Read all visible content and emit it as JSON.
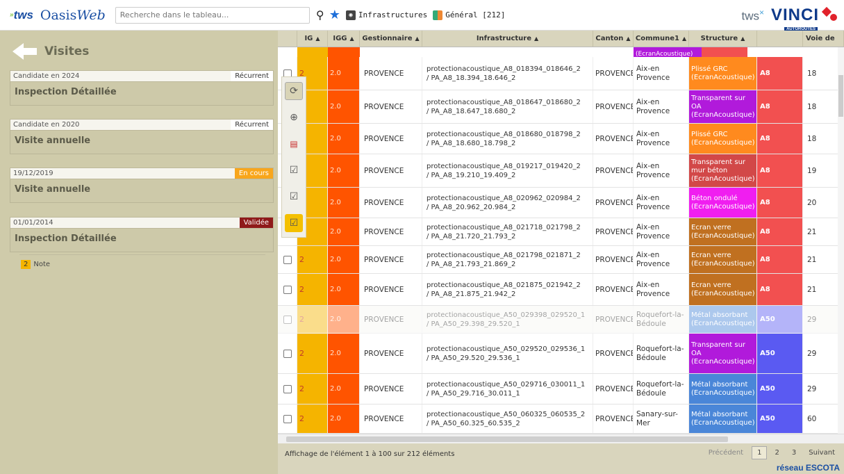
{
  "header": {
    "brand": "tws",
    "app_name_1": "Oasis",
    "app_name_2": "Web",
    "search_placeholder": "Recherche dans le tableau...",
    "chip_infra": "Infrastructures",
    "chip_general": "Général [212]",
    "right_brand": "tws",
    "right_brand_sup": "×",
    "vinci": "VINCI",
    "vinci_sub": "AUTOROUTES"
  },
  "left": {
    "title": "Visites",
    "cards": [
      {
        "label": "Candidate en 2024",
        "badge": "Récurrent",
        "badge_type": "rec",
        "body": "Inspection Détaillée"
      },
      {
        "label": "Candidate en 2020",
        "badge": "Récurrent",
        "badge_type": "rec",
        "body": "Visite annuelle"
      },
      {
        "label": "19/12/2019",
        "badge": "En cours",
        "badge_type": "cours",
        "body": "Visite annuelle"
      },
      {
        "label": "01/01/2014",
        "badge": "Validée",
        "badge_type": "val",
        "body": "Inspection Détaillée"
      }
    ],
    "note_count": "2",
    "note_label": "Note"
  },
  "table": {
    "columns": [
      "",
      "IG",
      "IGG",
      "Gestionnaire",
      "Infrastructure",
      "Canton",
      "Commune1",
      "Structure",
      "",
      "Voie de"
    ],
    "partial_struct": "(EcranAcoustique)",
    "rows": [
      {
        "ig": "2",
        "igg": "2.0",
        "gest": "PROVENCE",
        "infra1": "protectionacoustique_A8_018394_018646_2",
        "infra2": "/ PA_A8_18.394_18.646_2",
        "canton": "PROVENCE",
        "com1": "Aix-en",
        "com2": "Provence",
        "struct": [
          "Plissé GRC",
          "(EcranAcoustique)"
        ],
        "struct_color": "#ff8a1e",
        "route": "A8",
        "route_color": "#f25050",
        "voie": "18",
        "dim": false
      },
      {
        "ig": "2",
        "igg": "2.0",
        "gest": "PROVENCE",
        "infra1": "protectionacoustique_A8_018647_018680_2",
        "infra2": "/ PA_A8_18.647_18.680_2",
        "canton": "PROVENCE",
        "com1": "Aix-en",
        "com2": "Provence",
        "struct": [
          "Transparent sur",
          "OA",
          "(EcranAcoustique)"
        ],
        "struct_color": "#b11adb",
        "route": "A8",
        "route_color": "#f25050",
        "voie": "18",
        "dim": false
      },
      {
        "ig": "2",
        "igg": "2.0",
        "gest": "PROVENCE",
        "infra1": "protectionacoustique_A8_018680_018798_2",
        "infra2": "/ PA_A8_18.680_18.798_2",
        "canton": "PROVENCE",
        "com1": "Aix-en",
        "com2": "Provence",
        "struct": [
          "Plissé GRC",
          "(EcranAcoustique)"
        ],
        "struct_color": "#ff8a1e",
        "route": "A8",
        "route_color": "#f25050",
        "voie": "18",
        "dim": false
      },
      {
        "ig": "2",
        "igg": "2.0",
        "gest": "PROVENCE",
        "infra1": "protectionacoustique_A8_019217_019420_2",
        "infra2": "/ PA_A8_19.210_19.409_2",
        "canton": "PROVENCE",
        "com1": "Aix-en",
        "com2": "Provence",
        "struct": [
          "Transparent sur",
          "mur béton",
          "(EcranAcoustique)"
        ],
        "struct_color": "#d24848",
        "route": "A8",
        "route_color": "#f25050",
        "voie": "19",
        "dim": false
      },
      {
        "ig": "2",
        "igg": "2.0",
        "gest": "PROVENCE",
        "infra1": "protectionacoustique_A8_020962_020984_2",
        "infra2": "/ PA_A8_20.962_20.984_2",
        "canton": "PROVENCE",
        "com1": "Aix-en",
        "com2": "Provence",
        "struct": [
          "Béton ondulé",
          "(EcranAcoustique)"
        ],
        "struct_color": "#f01ef0",
        "route": "A8",
        "route_color": "#f25050",
        "voie": "20",
        "dim": false
      },
      {
        "ig": "2",
        "igg": "2.0",
        "gest": "PROVENCE",
        "infra1": "protectionacoustique_A8_021718_021798_2",
        "infra2": "/ PA_A8_21.720_21.793_2",
        "canton": "PROVENCE",
        "com1": "Aix-en",
        "com2": "Provence",
        "struct": [
          "Ecran verre",
          "(EcranAcoustique)"
        ],
        "struct_color": "#c07020",
        "route": "A8",
        "route_color": "#f25050",
        "voie": "21",
        "dim": false
      },
      {
        "ig": "2",
        "igg": "2.0",
        "gest": "PROVENCE",
        "infra1": "protectionacoustique_A8_021798_021871_2",
        "infra2": "/ PA_A8_21.793_21.869_2",
        "canton": "PROVENCE",
        "com1": "Aix-en",
        "com2": "Provence",
        "struct": [
          "Ecran verre",
          "(EcranAcoustique)"
        ],
        "struct_color": "#c07020",
        "route": "A8",
        "route_color": "#f25050",
        "voie": "21",
        "dim": false
      },
      {
        "ig": "2",
        "igg": "2.0",
        "gest": "PROVENCE",
        "infra1": "protectionacoustique_A8_021875_021942_2",
        "infra2": "/ PA_A8_21.875_21.942_2",
        "canton": "PROVENCE",
        "com1": "Aix-en",
        "com2": "Provence",
        "struct": [
          "Ecran verre",
          "(EcranAcoustique)"
        ],
        "struct_color": "#c07020",
        "route": "A8",
        "route_color": "#f25050",
        "voie": "21",
        "dim": false
      },
      {
        "ig": "2",
        "igg": "2.0",
        "gest": "PROVENCE",
        "infra1": "protectionacoustique_A50_029398_029520_1",
        "infra2": "/ PA_A50_29.398_29.520_1",
        "canton": "PROVENCE",
        "com1": "Roquefort-la-",
        "com2": "Bédoule",
        "struct": [
          "Métal absorbant",
          "(EcranAcoustique)"
        ],
        "struct_color": "#4a86d8",
        "route": "A50",
        "route_color": "#5a5af2",
        "voie": "29",
        "dim": true
      },
      {
        "ig": "2",
        "igg": "2.0",
        "gest": "PROVENCE",
        "infra1": "protectionacoustique_A50_029520_029536_1",
        "infra2": "/ PA_A50_29.520_29.536_1",
        "canton": "PROVENCE",
        "com1": "Roquefort-la-",
        "com2": "Bédoule",
        "struct": [
          "Transparent sur",
          "OA",
          "(EcranAcoustique)"
        ],
        "struct_color": "#b11adb",
        "route": "A50",
        "route_color": "#5a5af2",
        "voie": "29",
        "dim": false
      },
      {
        "ig": "2",
        "igg": "2.0",
        "gest": "PROVENCE",
        "infra1": "protectionacoustique_A50_029716_030011_1",
        "infra2": "/ PA_A50_29.716_30.011_1",
        "canton": "PROVENCE",
        "com1": "Roquefort-la-",
        "com2": "Bédoule",
        "struct": [
          "Métal absorbant",
          "(EcranAcoustique)"
        ],
        "struct_color": "#4a86d8",
        "route": "A50",
        "route_color": "#5a5af2",
        "voie": "29",
        "dim": false
      },
      {
        "ig": "2",
        "igg": "2.0",
        "gest": "PROVENCE",
        "infra1": "protectionacoustique_A50_060325_060535_2",
        "infra2": "/ PA_A50_60.325_60.535_2",
        "canton": "PROVENCE",
        "com1": "Sanary-sur-Mer",
        "com2": "",
        "struct": [
          "Métal absorbant",
          "(EcranAcoustique)"
        ],
        "struct_color": "#4a86d8",
        "route": "A50",
        "route_color": "#5a5af2",
        "voie": "60",
        "dim": false
      }
    ]
  },
  "footer": {
    "info": "Affichage de l'élément 1 à 100 sur 212 éléments",
    "prev": "Précédent",
    "pages": [
      "1",
      "2",
      "3"
    ],
    "next": "Suivant",
    "network": "réseau ESCOTA"
  },
  "colors": {
    "ig_bg": "#f5b400",
    "igg_bg": "#ff5400",
    "panel_bg": "#cfcbaa",
    "header_bg": "#d9d5bd",
    "accent": "#1a4fa3"
  }
}
